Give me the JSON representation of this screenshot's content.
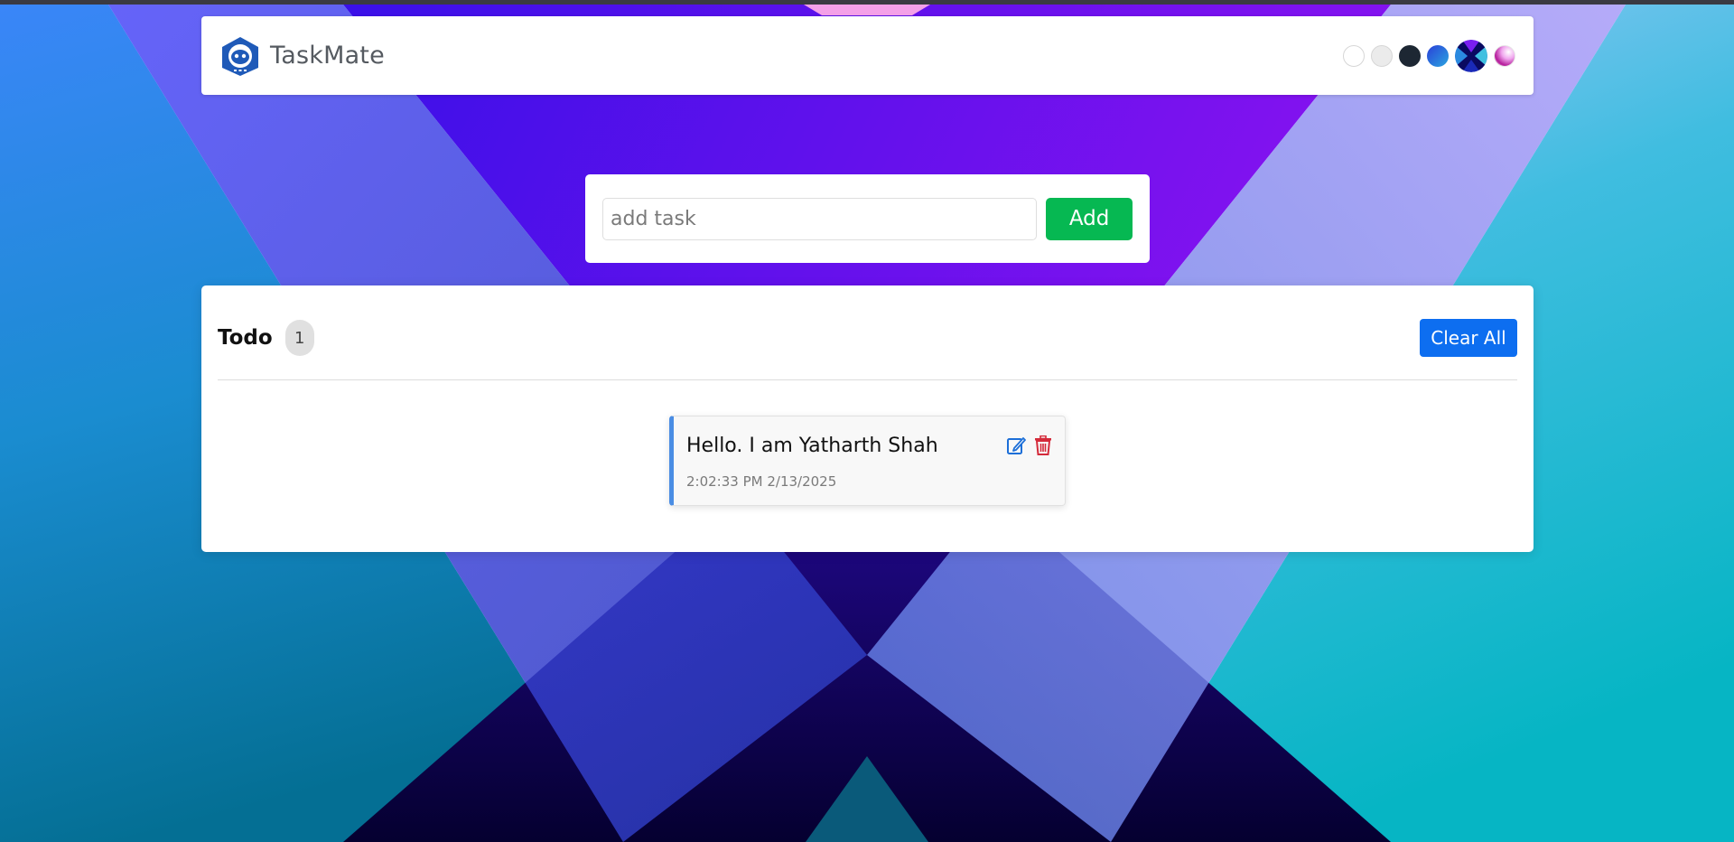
{
  "app": {
    "brand": "TaskMate",
    "logo_icon": "robot-icon"
  },
  "themes": {
    "items": [
      {
        "name": "light-theme",
        "color": "#ffffff"
      },
      {
        "name": "gray-theme",
        "color": "#ebebeb"
      },
      {
        "name": "dark-theme",
        "color": "#1d2733"
      },
      {
        "name": "blue-gradient-theme",
        "color": "#2a6fe0"
      },
      {
        "name": "x-pattern-theme",
        "color": "#3a1fd0"
      },
      {
        "name": "pink-theme",
        "color": "#f0a6ee"
      }
    ]
  },
  "add_task": {
    "placeholder": "add task",
    "value": "",
    "button_label": "Add"
  },
  "todo": {
    "title": "Todo",
    "count": "1",
    "clear_label": "Clear All",
    "items": [
      {
        "text": "Hello. I am Yatharth Shah",
        "timestamp": "2:02:33 PM 2/13/2025",
        "edit_icon": "edit-icon",
        "delete_icon": "trash-icon"
      }
    ]
  },
  "colors": {
    "add_button": "#06b852",
    "clear_button": "#0d6ef0",
    "task_accent": "#4a8de4",
    "edit_icon": "#1d6fd8",
    "delete_icon": "#d42a3a"
  }
}
